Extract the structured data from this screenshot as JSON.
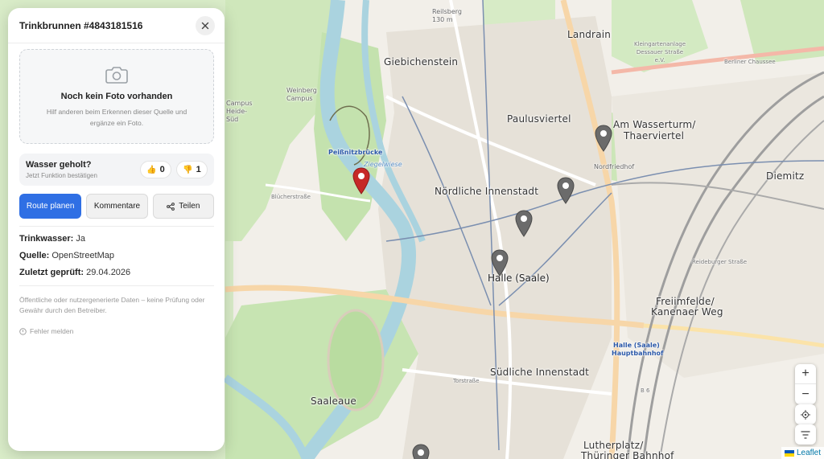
{
  "panel": {
    "title": "Trinkbrunnen #4843181516",
    "photo": {
      "title": "Noch kein Foto vorhanden",
      "subtitle": "Hilf anderen beim Erkennen dieser Quelle und ergänze ein Foto."
    },
    "water": {
      "question": "Wasser geholt?",
      "hint": "Jetzt Funktion bestätigen",
      "up_count": "0",
      "down_count": "1"
    },
    "actions": {
      "route": "Route planen",
      "comments": "Kommentare",
      "share": "Teilen"
    },
    "info": [
      {
        "label": "Trinkwasser:",
        "value": "Ja"
      },
      {
        "label": "Quelle:",
        "value": "OpenStreetMap"
      },
      {
        "label": "Zuletzt geprüft:",
        "value": "29.04.2026"
      }
    ],
    "disclaimer": "Öffentliche oder nutzergenerierte Daten – keine Prüfung oder Gewähr durch den Betreiber.",
    "report": "Fehler melden"
  },
  "map": {
    "labels": {
      "landrain": "Landrain",
      "giebichenstein": "Giebichenstein",
      "paulusviertel": "Paulusviertel",
      "wasserturm1": "Am Wasserturm/",
      "wasserturm2": "Thaerviertel",
      "diemitz": "Diemitz",
      "noerdliche": "Nördliche Innenstadt",
      "halle": "Halle (Saale)",
      "freiimfelde1": "Freiimfelde/",
      "freiimfelde2": "Kanenaer Weg",
      "suedliche": "Südliche Innenstadt",
      "saaleaue": "Saaleaue",
      "lutherplatz1": "Lutherplatz/",
      "lutherplatz2": "Thüringer Bahnhof",
      "peissnitz": "Peißnitzbrücke",
      "hbf1": "Halle (Saale)",
      "hbf2": "Hauptbahnhof",
      "berliner": "Berliner Chaussee",
      "reideburger": "Reideburger Straße",
      "nordfriedhof": "Nordfriedhof",
      "b6": "B 6",
      "kleingarten": "Kleingartenanlage Dessauer Straße e.V.",
      "bluecher": "Blücherstraße",
      "torstrasse": "Torstraße",
      "campus": "Campus Heide-Süd",
      "weinberg": "Weinberg Campus",
      "ziegelwiese": "Ziegelwiese",
      "reilsberg": "Reilsberg 130 m"
    },
    "zoom_in": "+",
    "zoom_out": "−",
    "attribution": "Leaflet"
  }
}
